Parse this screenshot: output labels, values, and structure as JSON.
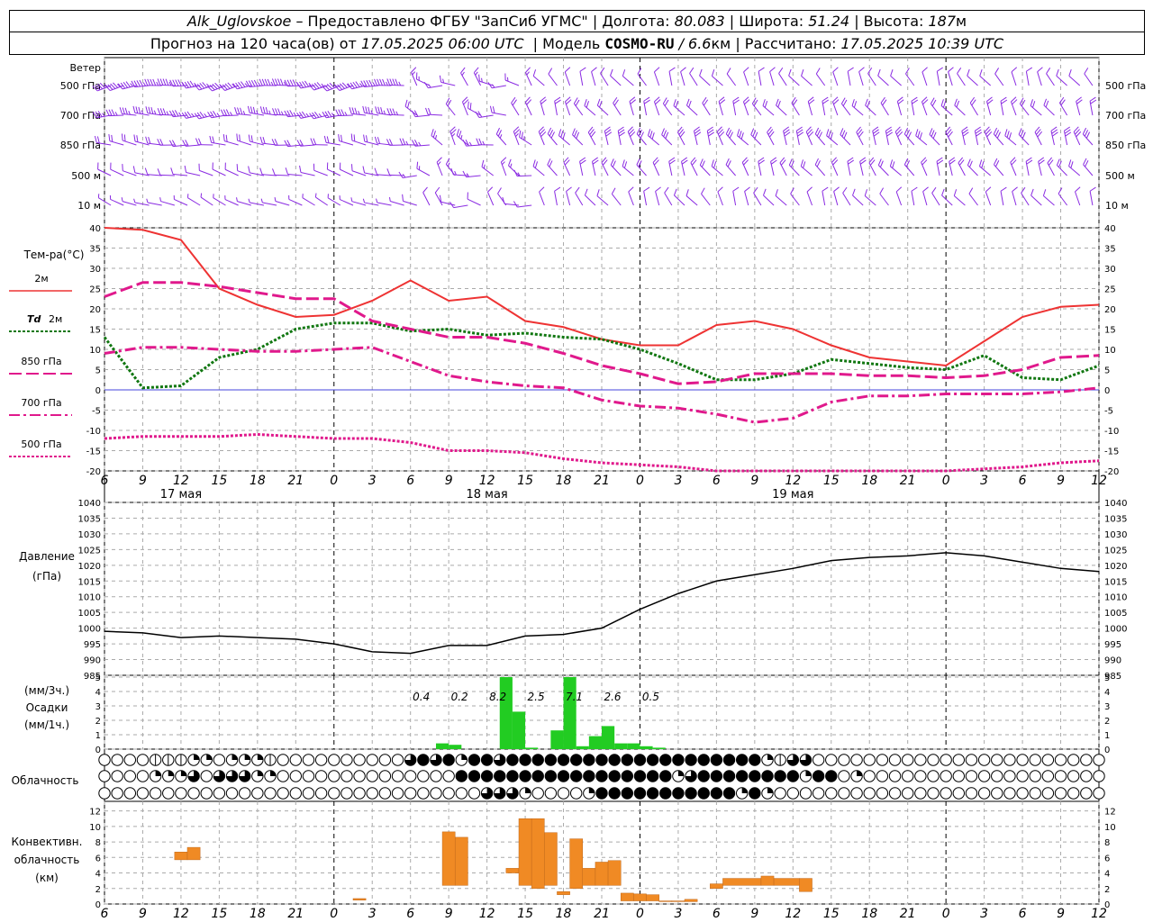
{
  "header": {
    "station": "Alk_Uglovskoe",
    "provider": "– Предоставлено ФГБУ \"ЗапСиб УГМС\" |",
    "lon_label": "Долгота:",
    "lon_value": "80.083",
    "lat_label": "| Широта:",
    "lat_value": "51.24",
    "alt_label": "| Высота:",
    "alt_value": "187",
    "alt_unit": "м",
    "forecast_label": "Прогноз на 120 часа(ов) от",
    "forecast_start": "17.05.2025 06:00 UTC",
    "model_label": "| Модель",
    "model_name": "COSMO-RU",
    "model_res": "/ 6.6",
    "model_unit": "км",
    "calc_label": "| Рассчитано:",
    "calc_time": "17.05.2025 10:39 UTC"
  },
  "colors": {
    "wind": "#8a2be2",
    "t2m": "#ee3333",
    "td2m": "#117711",
    "t850": "#e0198c",
    "t700": "#e0198c",
    "t500": "#e0198c",
    "pressure": "#000000",
    "precip": "#22cc22",
    "convective": "#f08a24",
    "zero_line": "#4444dd",
    "grid": "#aaaaaa"
  },
  "chart_data": [
    {
      "type": "wind-barbs",
      "panel": "wind",
      "title": "Ветер",
      "levels": [
        "500 гПа",
        "700 гПа",
        "850 гПа",
        "500 м",
        "10 м"
      ],
      "note": "barbs every 1h per level, direction rotating from westerly (day 1) to northerly/north-westerly (days 2-3)"
    },
    {
      "type": "line",
      "panel": "temperature",
      "ylabel": "Тем-ра(°C)",
      "ylim": [
        -20,
        40
      ],
      "yticks": [
        -20,
        -15,
        -10,
        -5,
        0,
        5,
        10,
        15,
        20,
        25,
        30,
        35,
        40
      ],
      "x_hours": [
        6,
        9,
        12,
        15,
        18,
        21,
        24,
        27,
        30,
        33,
        36,
        39,
        42,
        45,
        48,
        51,
        54,
        57,
        60,
        63,
        66,
        69,
        72,
        75,
        78,
        81,
        84
      ],
      "series": [
        {
          "name": "2м",
          "key": "t2m",
          "style": "solid",
          "values": [
            40,
            39.5,
            37,
            25,
            21,
            18,
            18.5,
            22,
            27,
            22,
            23,
            17,
            15.5,
            12.5,
            11,
            11,
            16,
            17,
            15,
            11,
            8,
            7,
            6,
            12,
            18,
            20.5,
            21
          ]
        },
        {
          "name": "Td 2м",
          "key": "td2m",
          "style": "dotted",
          "values": [
            13,
            0.5,
            1,
            8,
            10,
            15,
            16.5,
            16.5,
            14.5,
            15,
            13.5,
            14,
            13,
            12.5,
            10,
            6.5,
            2.5,
            2.5,
            4,
            7.5,
            6.5,
            5.5,
            5,
            8.5,
            3,
            2.5,
            6
          ]
        },
        {
          "name": "850 гПа",
          "key": "t850",
          "style": "dashed",
          "values": [
            23,
            26.5,
            26.5,
            25.5,
            24,
            22.5,
            22.5,
            17,
            15,
            13,
            13,
            11.5,
            9,
            6,
            4,
            1.5,
            2,
            4,
            4,
            4,
            3.5,
            3.5,
            3,
            3.5,
            5,
            8,
            8.5
          ]
        },
        {
          "name": "700 гПа",
          "key": "t700",
          "style": "dashdot",
          "values": [
            9,
            10.5,
            10.5,
            10,
            9.5,
            9.5,
            10,
            10.5,
            7,
            3.5,
            2,
            1,
            0.5,
            -2.5,
            -4,
            -4.5,
            -6,
            -8,
            -7,
            -3,
            -1.5,
            -1.5,
            -1,
            -1,
            -1,
            -0.5,
            0.5
          ]
        },
        {
          "name": "500 гПа",
          "key": "t500",
          "style": "dotted",
          "values": [
            -12,
            -11.5,
            -11.5,
            -11.5,
            -11,
            -11.5,
            -12,
            -12,
            -13,
            -15,
            -15,
            -15.5,
            -17,
            -18,
            -18.5,
            -19,
            -20,
            -20,
            -20,
            -20,
            -20,
            -20,
            -20,
            -19.5,
            -19,
            -18,
            -17.5
          ]
        }
      ]
    },
    {
      "type": "line",
      "panel": "pressure",
      "ylabel": "Давление",
      "yunit": "(гПа)",
      "ylim": [
        985,
        1040
      ],
      "yticks": [
        985,
        990,
        995,
        1000,
        1005,
        1010,
        1015,
        1020,
        1025,
        1030,
        1035,
        1040
      ],
      "x_hours": [
        6,
        9,
        12,
        15,
        18,
        21,
        24,
        27,
        30,
        33,
        36,
        39,
        42,
        45,
        48,
        51,
        54,
        57,
        60,
        63,
        66,
        69,
        72,
        75,
        78,
        81,
        84
      ],
      "values": [
        999,
        998.5,
        997,
        997.5,
        997,
        996.5,
        995,
        992.5,
        992,
        994.5,
        994.5,
        997.5,
        998,
        1000,
        1006,
        1011,
        1015,
        1017,
        1019,
        1021.5,
        1022.5,
        1023,
        1024,
        1023,
        1021,
        1019,
        1018
      ]
    },
    {
      "type": "bar",
      "panel": "precip",
      "ylabel": "Осадки",
      "yunit_top": "(мм/3ч.)",
      "yunit_bottom": "(мм/1ч.)",
      "ylim": [
        0,
        5
      ],
      "hourly_bars": [
        {
          "hour": 32.5,
          "value": 0.4
        },
        {
          "hour": 33.5,
          "value": 0.3
        },
        {
          "hour": 37.5,
          "value": 5.0
        },
        {
          "hour": 38.5,
          "value": 2.6
        },
        {
          "hour": 39.5,
          "value": 0.1
        },
        {
          "hour": 41.5,
          "value": 1.3
        },
        {
          "hour": 42.5,
          "value": 5.0
        },
        {
          "hour": 43.5,
          "value": 0.2
        },
        {
          "hour": 44.5,
          "value": 0.9
        },
        {
          "hour": 45.5,
          "value": 1.6
        },
        {
          "hour": 46.5,
          "value": 0.4
        },
        {
          "hour": 47.5,
          "value": 0.4
        },
        {
          "hour": 48.5,
          "value": 0.2
        },
        {
          "hour": 49.5,
          "value": 0.1
        }
      ],
      "sum_labels": [
        {
          "hour": 30,
          "label": "0.4"
        },
        {
          "hour": 33,
          "label": "0.2"
        },
        {
          "hour": 36,
          "label": "8.2"
        },
        {
          "hour": 39,
          "label": "2.5"
        },
        {
          "hour": 42,
          "label": "7.1"
        },
        {
          "hour": 45,
          "label": "2.6"
        },
        {
          "hour": 48,
          "label": "0.5"
        }
      ]
    },
    {
      "type": "symbols",
      "panel": "cloud",
      "ylabel": "Облачность",
      "rows": [
        {
          "key": "high",
          "cover_by_hour": "0000111220222100000000003434244344444444444444444444213300000000000000000000000000000"
        },
        {
          "key": "mid",
          "cover_by_hour": "0000222303332200000000000000444444444444444442344444444244020000000000000000000000000"
        },
        {
          "key": "low",
          "cover_by_hour": "0000000000000000000000000000003332000024444444444424200000000000000000000000000000000"
        }
      ]
    },
    {
      "type": "bar",
      "panel": "convective",
      "ylabel": "Конвективн. облачность",
      "yunit": "(км)",
      "ylim": [
        0,
        13
      ],
      "yticks": [
        0,
        2,
        4,
        6,
        8,
        10,
        12
      ],
      "segments": [
        {
          "h0": 11.5,
          "h1": 12.5,
          "base": 5.7,
          "top": 6.7
        },
        {
          "h0": 12.5,
          "h1": 13.5,
          "base": 5.7,
          "top": 7.3
        },
        {
          "h0": 25.5,
          "h1": 26.5,
          "base": 0.5,
          "top": 0.7
        },
        {
          "h0": 32.5,
          "h1": 33.5,
          "base": 2.4,
          "top": 9.3
        },
        {
          "h0": 33.5,
          "h1": 34.5,
          "base": 2.4,
          "top": 8.6
        },
        {
          "h0": 37.5,
          "h1": 38.5,
          "base": 4.0,
          "top": 4.6
        },
        {
          "h0": 38.5,
          "h1": 39.5,
          "base": 2.4,
          "top": 11.0
        },
        {
          "h0": 39.5,
          "h1": 40.5,
          "base": 2.0,
          "top": 11.0
        },
        {
          "h0": 40.5,
          "h1": 41.5,
          "base": 2.4,
          "top": 9.2
        },
        {
          "h0": 41.5,
          "h1": 42.5,
          "base": 1.2,
          "top": 1.6
        },
        {
          "h0": 42.5,
          "h1": 43.5,
          "base": 2.0,
          "top": 8.4
        },
        {
          "h0": 43.5,
          "h1": 44.5,
          "base": 2.4,
          "top": 4.6
        },
        {
          "h0": 44.5,
          "h1": 45.5,
          "base": 2.4,
          "top": 5.4
        },
        {
          "h0": 45.5,
          "h1": 46.5,
          "base": 2.4,
          "top": 5.6
        },
        {
          "h0": 46.5,
          "h1": 47.5,
          "base": 0.4,
          "top": 1.4
        },
        {
          "h0": 47.5,
          "h1": 48.5,
          "base": 0.4,
          "top": 1.3
        },
        {
          "h0": 48.5,
          "h1": 49.5,
          "base": 0.4,
          "top": 1.2
        },
        {
          "h0": 49.5,
          "h1": 50.5,
          "base": 0.3,
          "top": 0.4
        },
        {
          "h0": 50.5,
          "h1": 51.5,
          "base": 0.3,
          "top": 0.4
        },
        {
          "h0": 51.5,
          "h1": 52.5,
          "base": 0.3,
          "top": 0.6
        },
        {
          "h0": 53.5,
          "h1": 54.5,
          "base": 2.0,
          "top": 2.6
        },
        {
          "h0": 54.5,
          "h1": 57.5,
          "base": 2.4,
          "top": 3.3
        },
        {
          "h0": 57.5,
          "h1": 58.5,
          "base": 2.4,
          "top": 3.6
        },
        {
          "h0": 58.5,
          "h1": 60.5,
          "base": 2.4,
          "top": 3.3
        },
        {
          "h0": 60.5,
          "h1": 61.5,
          "base": 1.6,
          "top": 3.3
        }
      ]
    }
  ],
  "xaxis": {
    "start_hour": 6,
    "end_hour": 84,
    "tick_labels": [
      "6",
      "9",
      "12",
      "15",
      "18",
      "21",
      "0",
      "3",
      "6",
      "9",
      "12",
      "15",
      "18",
      "21",
      "0",
      "3",
      "6",
      "9",
      "12",
      "15",
      "18",
      "21",
      "0",
      "3",
      "6",
      "9",
      "12"
    ],
    "day_labels": [
      "17 мая",
      "18 мая",
      "19 мая"
    ]
  }
}
